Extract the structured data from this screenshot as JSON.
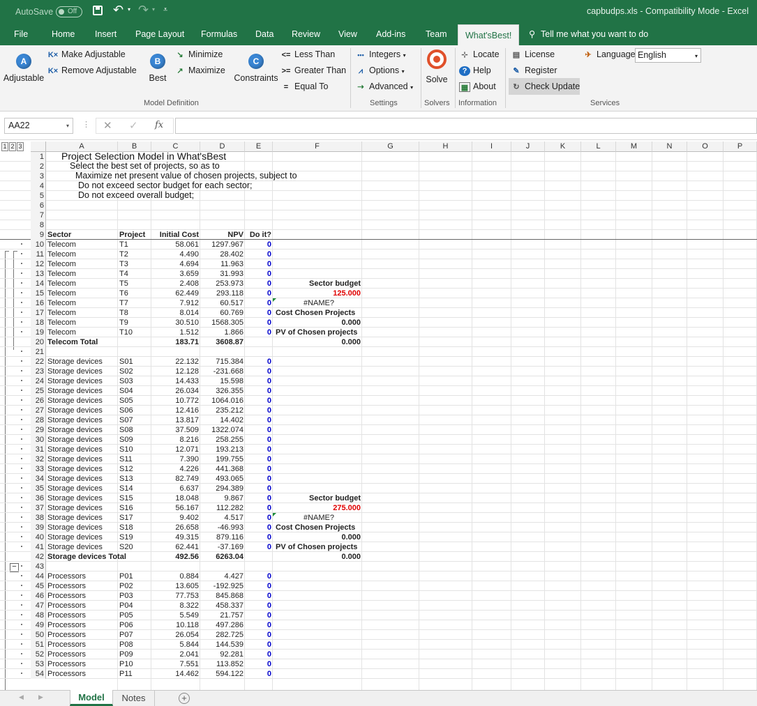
{
  "titlebar": {
    "autosave_label": "AutoSave",
    "autosave_state": "Off",
    "file_title": "capbudps.xls  -  Compatibility Mode  -  Excel",
    "save_icon": "save-icon",
    "undo_icon": "undo-icon",
    "redo_icon": "redo-icon"
  },
  "tabs": [
    "File",
    "Home",
    "Insert",
    "Page Layout",
    "Formulas",
    "Data",
    "Review",
    "View",
    "Add-ins",
    "Team",
    "What'sBest!"
  ],
  "tell_me": "Tell me what you want to do",
  "ribbon": {
    "adjustable": "Adjustable",
    "make_adjustable": "Make Adjustable",
    "remove_adjustable": "Remove Adjustable",
    "best": "Best",
    "minimize": "Minimize",
    "maximize": "Maximize",
    "constraints": "Constraints",
    "less_than": "Less Than",
    "greater_than": "Greater Than",
    "equal_to": "Equal To",
    "integers": "Integers",
    "options": "Options",
    "advanced": "Advanced",
    "solve": "Solve",
    "locate": "Locate",
    "help": "Help",
    "about": "About",
    "license": "License",
    "register": "Register",
    "check_update": "Check Update",
    "language_label": "Language",
    "language_value": "English",
    "groups": {
      "model_definition": "Model Definition",
      "settings": "Settings",
      "solvers": "Solvers",
      "information": "Information",
      "services": "Services"
    }
  },
  "formula_bar": {
    "name_box": "AA22",
    "fx": "fx",
    "formula": ""
  },
  "outline_levels": [
    "1",
    "2",
    "3"
  ],
  "columns": [
    "A",
    "B",
    "C",
    "D",
    "E",
    "F",
    "G",
    "H",
    "I",
    "J",
    "K",
    "L",
    "M",
    "N",
    "O",
    "P"
  ],
  "rows": [
    {
      "n": "1",
      "A": "Project Selection Model in What'sBest"
    },
    {
      "n": "2",
      "A": "Select the best set of projects,  so as to"
    },
    {
      "n": "3",
      "A": "Maximize net present value of chosen projects,  subject to"
    },
    {
      "n": "4",
      "A": "Do not exceed sector budget for each sector;"
    },
    {
      "n": "5",
      "A": "Do not exceed overall budget;"
    },
    {
      "n": "6"
    },
    {
      "n": "7"
    },
    {
      "n": "8"
    },
    {
      "n": "9",
      "A": "Sector",
      "B": "Project",
      "C": "Initial Cost",
      "D": "NPV",
      "E": "Do it?",
      "hdr": true
    },
    {
      "n": "10",
      "A": "Telecom",
      "B": "T1",
      "C": "58.061",
      "D": "1297.967",
      "E": "0"
    },
    {
      "n": "11",
      "A": "Telecom",
      "B": "T2",
      "C": "4.490",
      "D": "28.402",
      "E": "0"
    },
    {
      "n": "12",
      "A": "Telecom",
      "B": "T3",
      "C": "4.694",
      "D": "11.963",
      "E": "0"
    },
    {
      "n": "13",
      "A": "Telecom",
      "B": "T4",
      "C": "3.659",
      "D": "31.993",
      "E": "0"
    },
    {
      "n": "14",
      "A": "Telecom",
      "B": "T5",
      "C": "2.408",
      "D": "253.973",
      "E": "0",
      "F": "Sector budget",
      "Fs": "b"
    },
    {
      "n": "15",
      "A": "Telecom",
      "B": "T6",
      "C": "62.449",
      "D": "293.118",
      "E": "0",
      "F": "125.000",
      "Fs": "red"
    },
    {
      "n": "16",
      "A": "Telecom",
      "B": "T7",
      "C": "7.912",
      "D": "60.517",
      "E": "0",
      "F": "#NAME?",
      "Fs": "err"
    },
    {
      "n": "17",
      "A": "Telecom",
      "B": "T8",
      "C": "8.014",
      "D": "60.769",
      "E": "0",
      "F": "Cost Chosen Projects",
      "Fs": "b"
    },
    {
      "n": "18",
      "A": "Telecom",
      "B": "T9",
      "C": "30.510",
      "D": "1568.305",
      "E": "0",
      "F": "0.000",
      "Fs": "br"
    },
    {
      "n": "19",
      "A": "Telecom",
      "B": "T10",
      "C": "1.512",
      "D": "1.866",
      "E": "0",
      "F": "PV of Chosen projects",
      "Fs": "b"
    },
    {
      "n": "20",
      "A": "Telecom Total",
      "B": "",
      "C": "183.71",
      "D": "3608.87",
      "F": "0.000",
      "Fs": "br",
      "total": true
    },
    {
      "n": "21"
    },
    {
      "n": "22",
      "A": "Storage devices",
      "B": "S01",
      "C": "22.132",
      "D": "715.384",
      "E": "0"
    },
    {
      "n": "23",
      "A": "Storage devices",
      "B": "S02",
      "C": "12.128",
      "D": "-231.668",
      "E": "0"
    },
    {
      "n": "24",
      "A": "Storage devices",
      "B": "S03",
      "C": "14.433",
      "D": "15.598",
      "E": "0"
    },
    {
      "n": "25",
      "A": "Storage devices",
      "B": "S04",
      "C": "26.034",
      "D": "326.355",
      "E": "0"
    },
    {
      "n": "26",
      "A": "Storage devices",
      "B": "S05",
      "C": "10.772",
      "D": "1064.016",
      "E": "0"
    },
    {
      "n": "27",
      "A": "Storage devices",
      "B": "S06",
      "C": "12.416",
      "D": "235.212",
      "E": "0"
    },
    {
      "n": "28",
      "A": "Storage devices",
      "B": "S07",
      "C": "13.817",
      "D": "14.402",
      "E": "0"
    },
    {
      "n": "29",
      "A": "Storage devices",
      "B": "S08",
      "C": "37.509",
      "D": "1322.074",
      "E": "0"
    },
    {
      "n": "30",
      "A": "Storage devices",
      "B": "S09",
      "C": "8.216",
      "D": "258.255",
      "E": "0"
    },
    {
      "n": "31",
      "A": "Storage devices",
      "B": "S10",
      "C": "12.071",
      "D": "193.213",
      "E": "0"
    },
    {
      "n": "32",
      "A": "Storage devices",
      "B": "S11",
      "C": "7.390",
      "D": "199.755",
      "E": "0"
    },
    {
      "n": "33",
      "A": "Storage devices",
      "B": "S12",
      "C": "4.226",
      "D": "441.368",
      "E": "0"
    },
    {
      "n": "34",
      "A": "Storage devices",
      "B": "S13",
      "C": "82.749",
      "D": "493.065",
      "E": "0"
    },
    {
      "n": "35",
      "A": "Storage devices",
      "B": "S14",
      "C": "6.637",
      "D": "294.389",
      "E": "0"
    },
    {
      "n": "36",
      "A": "Storage devices",
      "B": "S15",
      "C": "18.048",
      "D": "9.867",
      "E": "0",
      "F": "Sector budget",
      "Fs": "b"
    },
    {
      "n": "37",
      "A": "Storage devices",
      "B": "S16",
      "C": "56.167",
      "D": "112.282",
      "E": "0",
      "F": "275.000",
      "Fs": "red"
    },
    {
      "n": "38",
      "A": "Storage devices",
      "B": "S17",
      "C": "9.402",
      "D": "4.517",
      "E": "0",
      "F": "#NAME?",
      "Fs": "err"
    },
    {
      "n": "39",
      "A": "Storage devices",
      "B": "S18",
      "C": "26.658",
      "D": "-46.993",
      "E": "0",
      "F": "Cost Chosen Projects",
      "Fs": "b"
    },
    {
      "n": "40",
      "A": "Storage devices",
      "B": "S19",
      "C": "49.315",
      "D": "879.116",
      "E": "0",
      "F": "0.000",
      "Fs": "br"
    },
    {
      "n": "41",
      "A": "Storage devices",
      "B": "S20",
      "C": "62.441",
      "D": "-37.169",
      "E": "0",
      "F": "PV of Chosen projects",
      "Fs": "b"
    },
    {
      "n": "42",
      "A": "Storage devices Total",
      "B": "",
      "C": "492.56",
      "D": "6263.04",
      "F": "0.000",
      "Fs": "br",
      "total": true
    },
    {
      "n": "43"
    },
    {
      "n": "44",
      "A": "Processors",
      "B": "P01",
      "C": "0.884",
      "D": "4.427",
      "E": "0"
    },
    {
      "n": "45",
      "A": "Processors",
      "B": "P02",
      "C": "13.605",
      "D": "-192.925",
      "E": "0"
    },
    {
      "n": "46",
      "A": "Processors",
      "B": "P03",
      "C": "77.753",
      "D": "845.868",
      "E": "0"
    },
    {
      "n": "47",
      "A": "Processors",
      "B": "P04",
      "C": "8.322",
      "D": "458.337",
      "E": "0"
    },
    {
      "n": "48",
      "A": "Processors",
      "B": "P05",
      "C": "5.549",
      "D": "21.757",
      "E": "0"
    },
    {
      "n": "49",
      "A": "Processors",
      "B": "P06",
      "C": "10.118",
      "D": "497.286",
      "E": "0"
    },
    {
      "n": "50",
      "A": "Processors",
      "B": "P07",
      "C": "26.054",
      "D": "282.725",
      "E": "0"
    },
    {
      "n": "51",
      "A": "Processors",
      "B": "P08",
      "C": "5.844",
      "D": "144.539",
      "E": "0"
    },
    {
      "n": "52",
      "A": "Processors",
      "B": "P09",
      "C": "2.041",
      "D": "92.281",
      "E": "0"
    },
    {
      "n": "53",
      "A": "Processors",
      "B": "P10",
      "C": "7.551",
      "D": "113.852",
      "E": "0"
    },
    {
      "n": "54",
      "A": "Processors",
      "B": "P11",
      "C": "14.462",
      "D": "594.122",
      "E": "0"
    }
  ],
  "sheets": [
    "Model",
    "Notes"
  ],
  "add_sheet": "+",
  "colors": {
    "excel_green": "#217346",
    "value_blue": "#0000cc",
    "budget_red": "#e00000"
  }
}
